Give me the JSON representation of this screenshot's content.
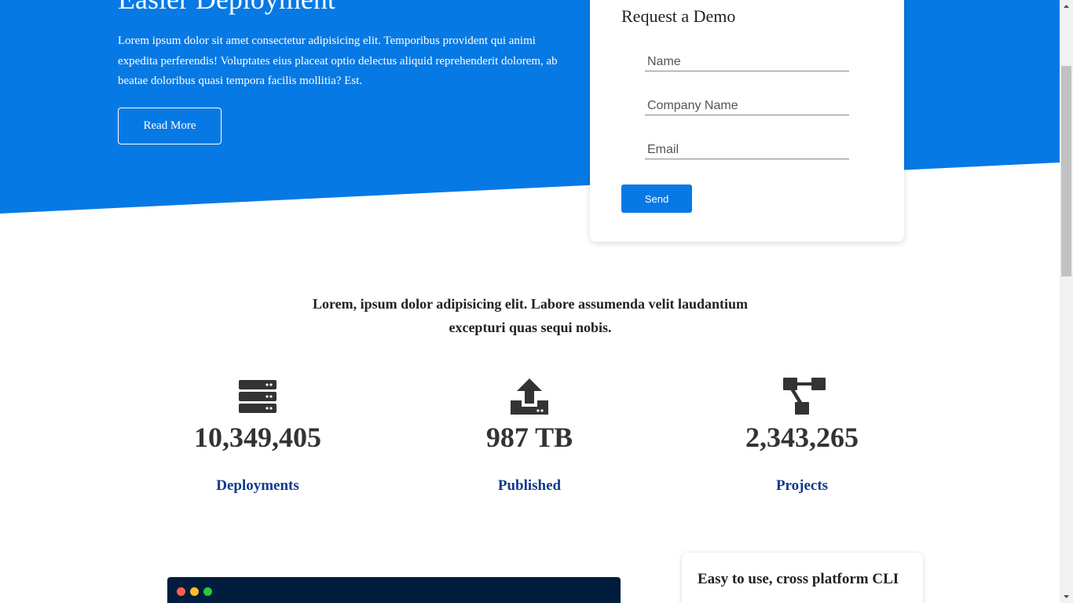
{
  "colors": {
    "accent": "#0779e4",
    "terminal_bg": "#001d3d",
    "stat_label": "#123a8c"
  },
  "hero": {
    "title": "Easier Deployment",
    "text": "Lorem ipsum dolor sit amet consectetur adipisicing elit. Temporibus provident qui animi expedita perferendis! Voluptates eius placeat optio delectus aliquid reprehenderit dolorem, ab beatae doloribus quasi tempora facilis mollitia? Est.",
    "read_more_label": "Read More"
  },
  "demo_form": {
    "title": "Request a Demo",
    "name_placeholder": "Name",
    "company_placeholder": "Company Name",
    "email_placeholder": "Email",
    "send_label": "Send"
  },
  "stats": {
    "intro": "Lorem, ipsum dolor adipisicing elit. Labore assumenda velit laudantium excepturi quas sequi nobis.",
    "items": [
      {
        "icon": "server-icon",
        "value": "10,349,405",
        "label": "Deployments"
      },
      {
        "icon": "upload-icon",
        "value": "987 TB",
        "label": "Published"
      },
      {
        "icon": "project-diagram-icon",
        "value": "2,343,265",
        "label": "Projects"
      }
    ]
  },
  "terminal": {
    "dots": [
      "#ff5f56",
      "#ffbd2e",
      "#27c93f"
    ]
  },
  "feature": {
    "title": "Easy to use, cross platform CLI"
  }
}
